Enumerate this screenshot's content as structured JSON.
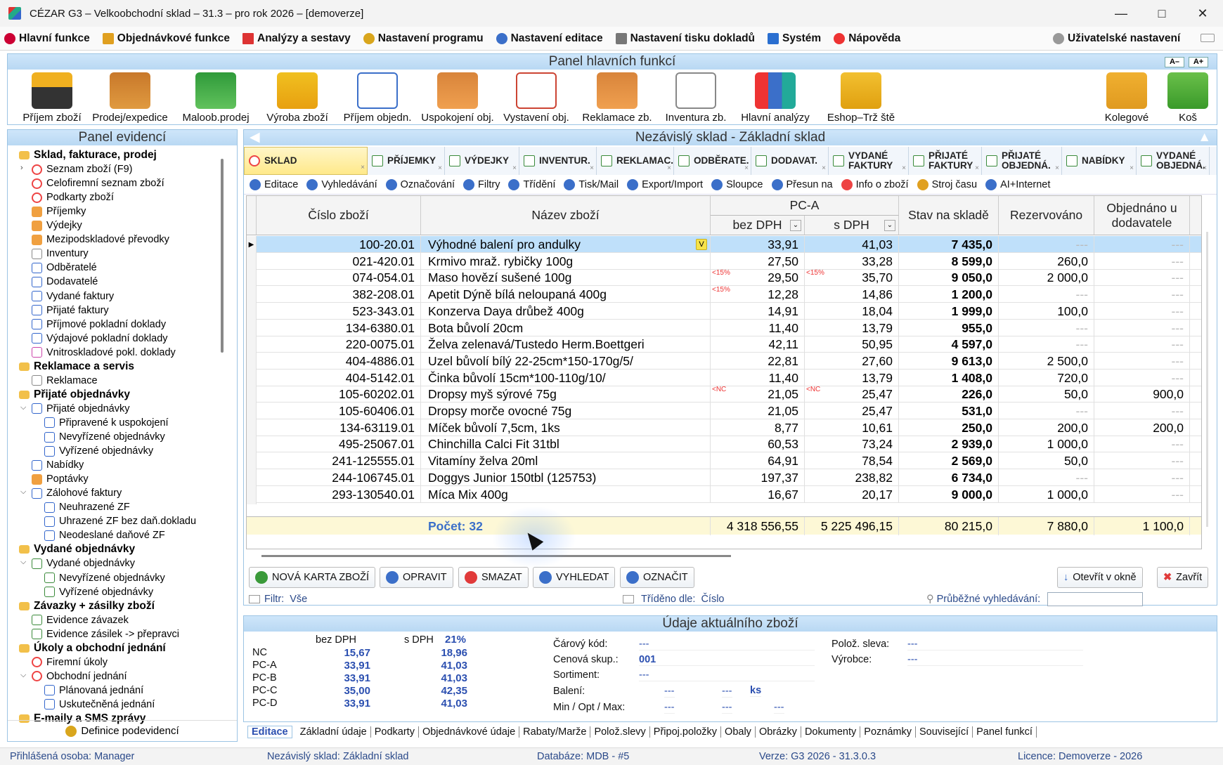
{
  "window": {
    "title": "CÉZAR G3 – Velkoobchodní sklad – 31.3 – pro rok 2026 – [demoverze]"
  },
  "menu": [
    "Hlavní funkce",
    "Objednávkové funkce",
    "Analýzy a sestavy",
    "Nastavení programu",
    "Nastavení editace",
    "Nastavení tisku dokladů",
    "Systém",
    "Nápověda"
  ],
  "menu_right": "Uživatelské nastavení",
  "main_panel": {
    "title": "Panel hlavních funkcí",
    "zoom_minus": "A–",
    "zoom_plus": "A+",
    "tools": [
      "Příjem zboží",
      "Prodej/expedice",
      "Maloob.prodej",
      "Výroba zboží",
      "Příjem objedn.",
      "Uspokojení obj.",
      "Vystavení obj.",
      "Reklamace zb.",
      "Inventura zb.",
      "Hlavní analýzy",
      "Eshop–Trž ště"
    ],
    "tools_right": [
      "Kolegové",
      "Koš"
    ]
  },
  "left_panel": {
    "title": "Panel evidencí",
    "items": [
      "Sklad, fakturace, prodej",
      "Seznam zboží (F9)",
      "Celofiremní seznam zboží",
      "Podkarty zboží",
      "Příjemky",
      "Výdejky",
      "Mezipodskladové převodky",
      "Inventury",
      "Odběratelé",
      "Dodavatelé",
      "Vydané faktury",
      "Přijaté faktury",
      "Příjmové pokladní doklady",
      "Výdajové pokladní doklady",
      "Vnitroskladové pokl. doklady",
      "Reklamace a servis",
      "Reklamace",
      "Přijaté objednávky",
      "Přijaté objednávky",
      "Připravené k uspokojení",
      "Nevyřízené objednávky",
      "Vyřízené objednávky",
      "Nabídky",
      "Poptávky",
      "Zálohové faktury",
      "Neuhrazené ZF",
      "Uhrazené ZF bez daň.dokladu",
      "Neodeslané daňové ZF",
      "Vydané objednávky",
      "Vydané objednávky",
      "Nevyřízené objednávky",
      "Vyřízené objednávky",
      "Závazky + zásilky zboží",
      "Evidence závazek",
      "Evidence zásilek -> přepravci",
      "Úkoly a obchodní jednání",
      "Firemní úkoly",
      "Obchodní jednání",
      "Plánovaná jednání",
      "Uskutečněná jednání",
      "E-maily a SMS zprávy"
    ],
    "footer": "Definice podevidencí"
  },
  "right_panel": {
    "title": "Nezávislý sklad - Základní sklad",
    "tabs": [
      "SKLAD",
      "PŘÍJEMKY",
      "VÝDEJKY",
      "INVENTUR.",
      "REKLAMAC.",
      "ODBĚRATE.",
      "DODAVAT.",
      "VYDANÉ FAKTURY",
      "PŘIJATÉ FAKTURY",
      "PŘIJATÉ OBJEDNÁ.",
      "NABÍDKY",
      "VYDANÉ OBJEDNÁ."
    ],
    "actions": [
      "Editace",
      "Vyhledávání",
      "Označování",
      "Filtry",
      "Třídění",
      "Tisk/Mail",
      "Export/Import",
      "Sloupce",
      "Přesun na",
      "Info o zboží",
      "Stroj času",
      "AI+Internet"
    ]
  },
  "grid": {
    "headers": {
      "code": "Číslo zboží",
      "name": "Název zboží",
      "group": "PC-A",
      "net": "bez DPH",
      "gross": "s DPH",
      "stock": "Stav na skladě",
      "reserved": "Rezervováno",
      "ordered": "Objednáno u dodavatele"
    },
    "rows": [
      {
        "code": "100-20.01",
        "name": "Výhodné balení pro andulky",
        "tag": "",
        "net": "33,91",
        "gross": "41,03",
        "stock": "7 435,0",
        "reserved": "---",
        "ordered": "---",
        "v": "V"
      },
      {
        "code": "021-420.01",
        "name": "Krmivo mraž. rybičky 100g",
        "tag": "",
        "net": "27,50",
        "gross": "33,28",
        "stock": "8 599,0",
        "reserved": "260,0",
        "ordered": "---"
      },
      {
        "code": "074-054.01",
        "name": "Maso hovězí sušené 100g",
        "tag": "<15%",
        "net": "29,50",
        "gross": "35,70",
        "stock": "9 050,0",
        "reserved": "2 000,0",
        "ordered": "---"
      },
      {
        "code": "382-208.01",
        "name": "Apetit Dýně bílá neloupaná 400g",
        "tag": "<15%",
        "net": "12,28",
        "gross": "14,86",
        "stock": "1 200,0",
        "reserved": "---",
        "ordered": "---"
      },
      {
        "code": "523-343.01",
        "name": "Konzerva Daya drůbež 400g",
        "tag": "",
        "net": "14,91",
        "gross": "18,04",
        "stock": "1 999,0",
        "reserved": "100,0",
        "ordered": "---"
      },
      {
        "code": "134-6380.01",
        "name": "Bota bůvolí 20cm",
        "tag": "",
        "net": "11,40",
        "gross": "13,79",
        "stock": "955,0",
        "reserved": "---",
        "ordered": "---"
      },
      {
        "code": "220-0075.01",
        "name": "Želva zelenavá/Tustedo Herm.Boettgeri",
        "tag": "",
        "net": "42,11",
        "gross": "50,95",
        "stock": "4 597,0",
        "reserved": "---",
        "ordered": "---"
      },
      {
        "code": "404-4886.01",
        "name": "Uzel bůvolí bílý 22-25cm*150-170g/5/",
        "tag": "",
        "net": "22,81",
        "gross": "27,60",
        "stock": "9 613,0",
        "reserved": "2 500,0",
        "ordered": "---"
      },
      {
        "code": "404-5142.01",
        "name": "Činka bůvolí 15cm*100-110g/10/",
        "tag": "",
        "net": "11,40",
        "gross": "13,79",
        "stock": "1 408,0",
        "reserved": "720,0",
        "ordered": "---"
      },
      {
        "code": "105-60202.01",
        "name": "Dropsy myš sýrové 75g",
        "tag": "<NC",
        "net": "21,05",
        "gross": "25,47",
        "stock": "226,0",
        "reserved": "50,0",
        "ordered": "900,0"
      },
      {
        "code": "105-60406.01",
        "name": "Dropsy morče ovocné 75g",
        "tag": "",
        "net": "21,05",
        "gross": "25,47",
        "stock": "531,0",
        "reserved": "---",
        "ordered": "---"
      },
      {
        "code": "134-63119.01",
        "name": "Míček bůvolí 7,5cm, 1ks",
        "tag": "",
        "net": "8,77",
        "gross": "10,61",
        "stock": "250,0",
        "reserved": "200,0",
        "ordered": "200,0"
      },
      {
        "code": "495-25067.01",
        "name": "Chinchilla Calci Fit 31tbl",
        "tag": "",
        "net": "60,53",
        "gross": "73,24",
        "stock": "2 939,0",
        "reserved": "1 000,0",
        "ordered": "---"
      },
      {
        "code": "241-125555.01",
        "name": "Vitamíny želva 20ml",
        "tag": "",
        "net": "64,91",
        "gross": "78,54",
        "stock": "2 569,0",
        "reserved": "50,0",
        "ordered": "---"
      },
      {
        "code": "244-106745.01",
        "name": "Doggys Junior 150tbl (125753)",
        "tag": "",
        "net": "197,37",
        "gross": "238,82",
        "stock": "6 734,0",
        "reserved": "---",
        "ordered": "---"
      },
      {
        "code": "293-130540.01",
        "name": "Míca Mix 400g",
        "tag": "",
        "net": "16,67",
        "gross": "20,17",
        "stock": "9 000,0",
        "reserved": "1 000,0",
        "ordered": "---"
      }
    ],
    "summary": {
      "count": "Počet: 32",
      "net": "4 318 556,55",
      "gross": "5 225 496,15",
      "stock": "80 215,0",
      "reserved": "7 880,0",
      "ordered": "1 100,0"
    }
  },
  "buttons": {
    "new": "NOVÁ KARTA ZBOŽÍ",
    "edit": "OPRAVIT",
    "delete": "SMAZAT",
    "search": "VYHLEDAT",
    "mark": "OZNAČIT",
    "open_window": "Otevřít v okně",
    "close": "Zavřít"
  },
  "filter": {
    "filter_label": "Filtr:",
    "filter_value": "Vše",
    "sort_label": "Tříděno dle:",
    "sort_value": "Číslo",
    "search_label": "Průběžné vyhledávání:"
  },
  "detail": {
    "title": "Údaje aktuálního zboží",
    "col_net": "bez DPH",
    "col_gross": "s DPH",
    "vat": "21%",
    "prices": [
      {
        "label": "NC",
        "net": "15,67",
        "gross": "18,96"
      },
      {
        "label": "PC-A",
        "net": "33,91",
        "gross": "41,03"
      },
      {
        "label": "PC-B",
        "net": "33,91",
        "gross": "41,03"
      },
      {
        "label": "PC-C",
        "net": "35,00",
        "gross": "42,35"
      },
      {
        "label": "PC-D",
        "net": "33,91",
        "gross": "41,03"
      }
    ],
    "barcode_label": "Čárový kód:",
    "barcode": "---",
    "pricegroup_label": "Cenová skup.:",
    "pricegroup": "001",
    "assort_label": "Sortiment:",
    "assort": "---",
    "pack_label": "Balení:",
    "pack1": "---",
    "pack2": "---",
    "pack_unit": "ks",
    "minmax_label": "Min / Opt / Max:",
    "min": "---",
    "opt": "---",
    "max": "---",
    "discount_label": "Polož. sleva:",
    "discount": "---",
    "maker_label": "Výrobce:",
    "maker": "---"
  },
  "detail_tabs": [
    "Editace",
    "Základní údaje",
    "Podkarty",
    "Objednávkové údaje",
    "Rabaty/Marže",
    "Polož.slevy",
    "Připoj.položky",
    "Obaly",
    "Obrázky",
    "Dokumenty",
    "Poznámky",
    "Související",
    "Panel funkcí"
  ],
  "status": {
    "user": "Přihlášená osoba:  Manager",
    "store": "Nezávislý sklad:  Základní sklad",
    "db": "Databáze:  MDB - #5",
    "version": "Verze:  G3 2026 - 31.3.0.3",
    "license": "Licence:  Demoverze - 2026"
  }
}
